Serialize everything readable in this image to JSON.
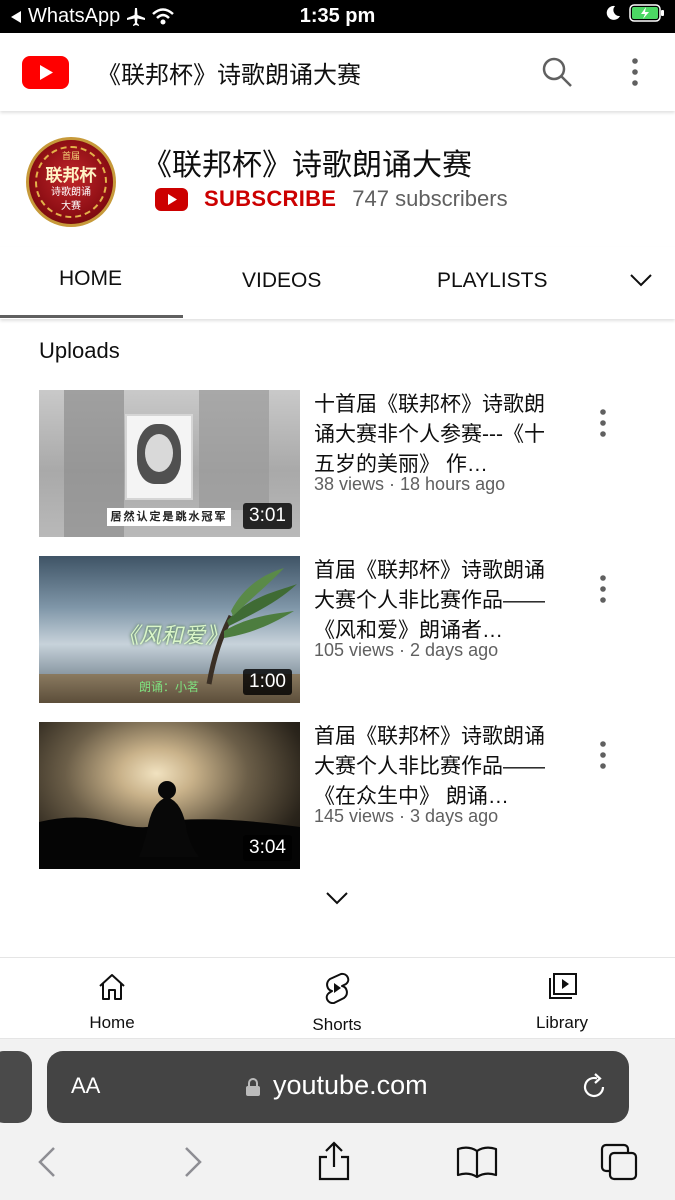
{
  "status_bar": {
    "back_label": "WhatsApp",
    "time": "1:35 pm"
  },
  "header": {
    "title": "《联邦杯》诗歌朗诵大赛"
  },
  "channel": {
    "name": "《联邦杯》诗歌朗诵大赛",
    "subscribe_label": "SUBSCRIBE",
    "subscribers": "747 subscribers",
    "avatar_text": {
      "top": "首届",
      "main": "联邦杯",
      "line2": "诗歌朗诵",
      "line3": "大赛"
    }
  },
  "tabs": [
    {
      "label": "HOME",
      "active": true
    },
    {
      "label": "VIDEOS",
      "active": false
    },
    {
      "label": "PLAYLISTS",
      "active": false
    }
  ],
  "uploads": {
    "title": "Uploads",
    "videos": [
      {
        "title": "十首届《联邦杯》诗歌朗诵大赛非个人参赛---《十五岁的美丽》 作…",
        "meta": "38 views · 18 hours ago",
        "duration": "3:01",
        "caption": "居然认定是跳水冠军"
      },
      {
        "title": "首届《联邦杯》诗歌朗诵大赛个人非比赛作品——《风和爱》朗诵者…",
        "meta": "105 views · 2 days ago",
        "duration": "1:00",
        "caption": "《风和爱》",
        "sub_caption": "朗诵：小茗"
      },
      {
        "title": "首届《联邦杯》诗歌朗诵大赛个人非比赛作品——《在众生中》 朗诵…",
        "meta": "145 views · 3 days ago",
        "duration": "3:04"
      }
    ]
  },
  "bottom_nav": [
    {
      "label": "Home",
      "icon": "home-icon"
    },
    {
      "label": "Shorts",
      "icon": "shorts-icon"
    },
    {
      "label": "Library",
      "icon": "library-icon"
    }
  ],
  "safari": {
    "text_size_label": "AA",
    "url": "youtube.com"
  },
  "colors": {
    "youtube_red": "#ff0000",
    "subscribe_red": "#cc0000",
    "meta_gray": "#606060"
  }
}
